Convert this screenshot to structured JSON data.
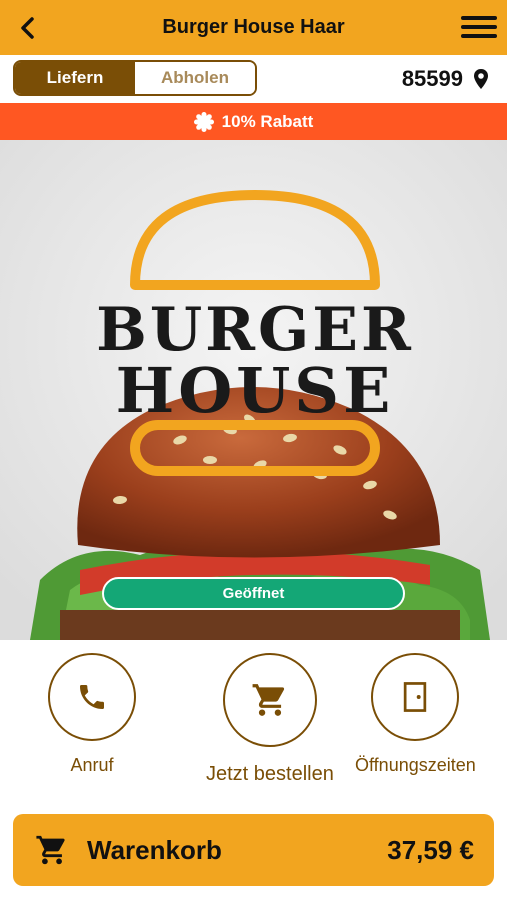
{
  "header": {
    "title": "Burger House Haar"
  },
  "mode": {
    "options": [
      "Liefern",
      "Abholen"
    ],
    "selected": "Liefern"
  },
  "location": {
    "zip": "85599"
  },
  "promo": {
    "text": "10% Rabatt"
  },
  "hero": {
    "logo_line1": "BURGER",
    "logo_line2": "HOUSE",
    "status": "Geöffnet"
  },
  "actions": [
    {
      "label": "Anruf",
      "icon": "phone-icon"
    },
    {
      "label": "Jetzt bestellen",
      "icon": "cart-icon"
    },
    {
      "label": "Öffnungszeiten",
      "icon": "door-icon"
    }
  ],
  "cart": {
    "label": "Warenkorb",
    "total": "37,59 €"
  },
  "colors": {
    "brand": "#F2A51F",
    "accent_dark": "#7a4e06",
    "promo": "#FF5722",
    "open_status": "#14A776"
  }
}
